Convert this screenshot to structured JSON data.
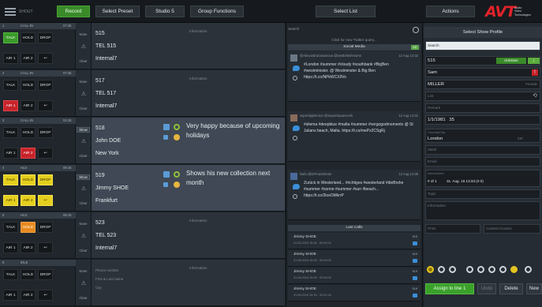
{
  "topbar": {
    "shout": "SHOUT",
    "record": "Record",
    "select_preset": "Select Preset",
    "studio": "Studio 5",
    "group_functions": "Group Functions",
    "select_list": "Select List",
    "actions": "Actions",
    "logo": "AVT",
    "logo_sub": [
      "Audio",
      "Video",
      "Technologies"
    ]
  },
  "lines": [
    {
      "head": [
        "1",
        "CALL-IN",
        "07:45"
      ],
      "buttons": [
        "TALK",
        "HOLD",
        "DROP",
        "AIR 1",
        "AIR 2",
        "↩"
      ],
      "side": [
        "None",
        "Clear",
        "0"
      ],
      "number": "515",
      "tel": "TEL 515",
      "note": "Internal7",
      "info": "Information"
    },
    {
      "head": [
        "2",
        "CALL-IN",
        "07:45"
      ],
      "buttons": [
        "TALK",
        "HOLD",
        "DROP",
        "AIR 1",
        "AIR 2",
        "↩"
      ],
      "side": [
        "None",
        "Clear",
        "0"
      ],
      "number": "517",
      "tel": "TEL 517",
      "note": "Internal7",
      "info": "Information"
    },
    {
      "head": [
        "3",
        "CALL-IN",
        "04:15"
      ],
      "buttons": [
        "TALK",
        "HOLD",
        "DROP",
        "AIR 1",
        "AIR 2",
        "↩"
      ],
      "side": [
        "Show",
        "Clear",
        "0"
      ],
      "number": "518",
      "tel": "John DOE",
      "note": "New York",
      "info": "Very happy because of upcoming holidays"
    },
    {
      "head": [
        "4",
        "HLD",
        "09:15"
      ],
      "buttons": [
        "TALK",
        "HOLD",
        "DROP",
        "AIR 1",
        "AIR 2",
        "↩"
      ],
      "side": [
        "Show",
        "Clear",
        "0"
      ],
      "number": "519",
      "tel": "Jimmy SHOE",
      "note": "Frankfurt",
      "info": "Shows his new collection next month"
    },
    {
      "head": [
        "5",
        "HLD",
        "08:15"
      ],
      "buttons": [
        "TALK",
        "HOLD",
        "DROP",
        "AIR 1",
        "AIR 2",
        "↩"
      ],
      "side": [
        "None",
        "Clear",
        "0"
      ],
      "number": "523",
      "tel": "TEL 523",
      "note": "Internal7",
      "info": "Information"
    },
    {
      "head": [
        "6",
        "IDLE",
        ""
      ],
      "buttons": [
        "TALK",
        "HOLD",
        "DROP",
        "AIR 1",
        "AIR 2",
        "↩"
      ],
      "side": [
        "None",
        "Clear",
        "0"
      ],
      "number": "Phone number",
      "tel": "First & Last name",
      "note": "City",
      "info": "Information"
    }
  ],
  "social": {
    "search_placeholder": "Search",
    "click_new": "Click for new Twitter query...",
    "header": "Social Media",
    "count": "22",
    "tweets": [
      {
        "author": "@AlexandraCasanova @bestbritishmoms",
        "time": "12 Aug 14:32",
        "text": "#London #summer #cloudy #southbank #BigBen #westminister. @ Westminster & Big Ben https://t.co/NPkWCXlIVo"
      },
      {
        "author": "supertippileroun @SuperSquareAsh",
        "time": "12 Aug 14:41",
        "text": "#sliema #deepblue #malta #summer #vergogodmoments @ St Julians beach, Malta. https://t.co/mePz2CSgRj"
      },
      {
        "author": "Dafu @DrFranzDieter",
        "time": "12 Aug 14:38",
        "text": "Zurück in Westerland... #richtiges #westerland #dieBrshe #summer #sonne #summer #sun #beach... https://t.co/2losOMkrrP"
      }
    ]
  },
  "last_calls": {
    "header": "Last Calls",
    "items": [
      {
        "name": "Jimmy SHOE",
        "date": "31.08.2016 15:36 · 00:02:00",
        "number": "519"
      },
      {
        "name": "Jimmy SHOE",
        "date": "31.08.2016 15:35 · 00:00:00",
        "number": "519"
      },
      {
        "name": "Jimmy SHOE",
        "date": "31.08.2016 15:35 · 00:00:00",
        "number": "519"
      },
      {
        "name": "Jimmy SHOE",
        "date": "31.08.2016 15:34 · 00:00:18",
        "number": "519"
      }
    ]
  },
  "profile": {
    "title": "Select Show Profile",
    "search": "Search",
    "number": "515",
    "badge": "Unknown",
    "first_name": "Sam",
    "last_name": "MILLER",
    "gender": "Female",
    "list": "List",
    "remark": "Remark",
    "birthday": "1/1/1981",
    "age": "35",
    "country_label": "Country/City",
    "city": "London",
    "zip": "ZIP",
    "email": "eMail",
    "email2": "Email",
    "interview": "Interviewed",
    "nr": "# of 1",
    "interview_date": "31. Aug. 16  13:33  (0 0)",
    "topic": "Topic",
    "information": "Information",
    "prize": "Prize",
    "contest": "Contest location",
    "assign": "Assign to line 1",
    "undo": "Undo",
    "delete": "Delete",
    "new": "New"
  },
  "colors": {
    "accent_green": "#3a9a2a",
    "alert_red": "#c8232a",
    "hold_yellow": "#e5cf1d",
    "hold_orange": "#e98a1f",
    "twitter_blue": "#3b8fd8"
  }
}
